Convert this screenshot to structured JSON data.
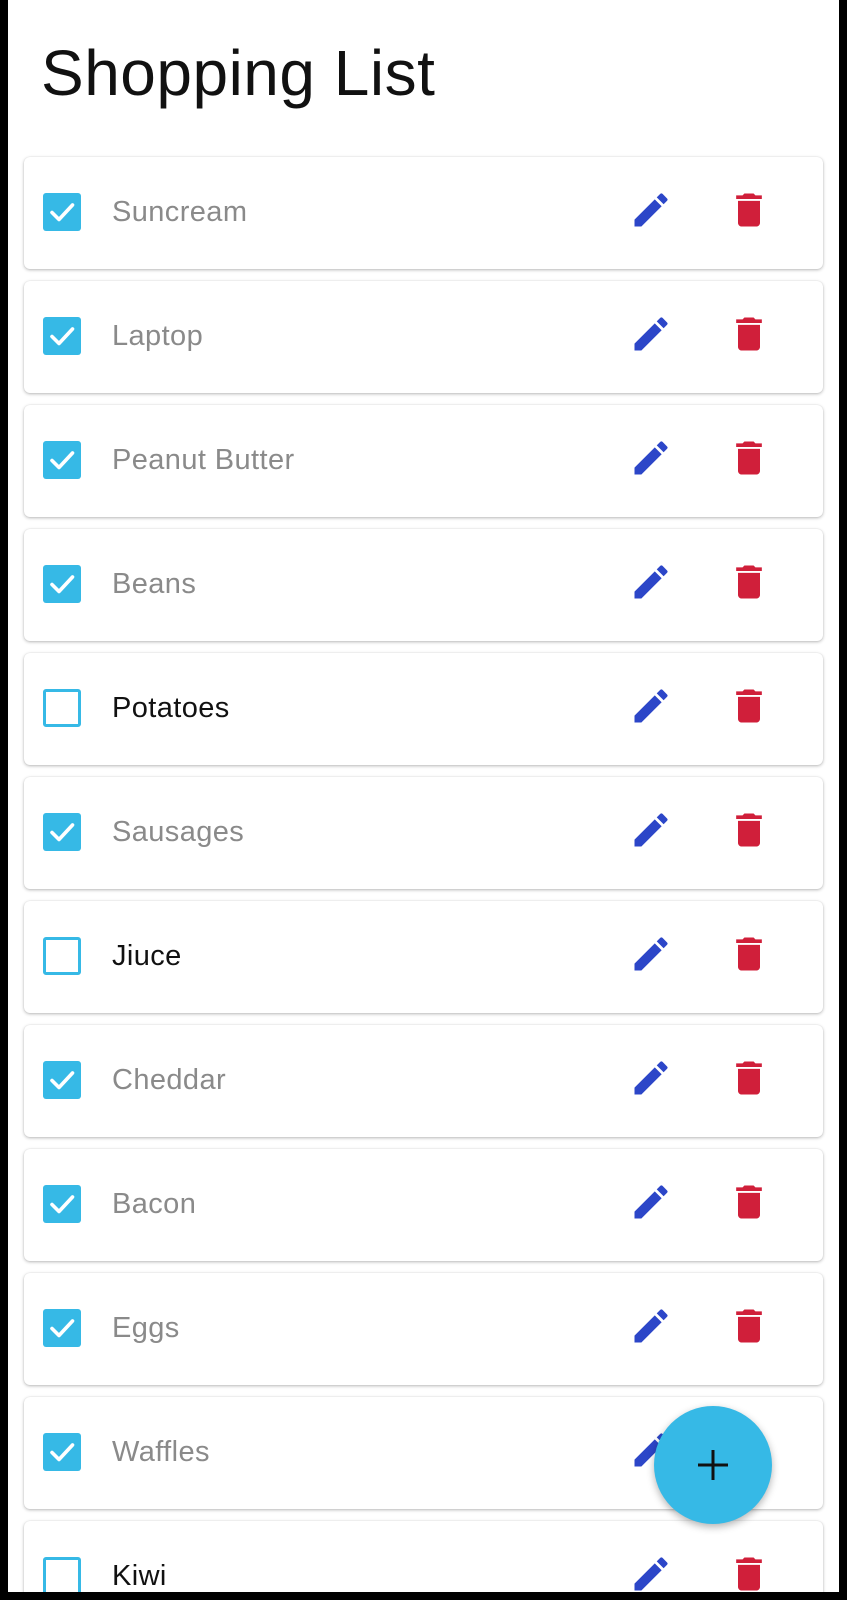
{
  "page": {
    "title": "Shopping List"
  },
  "colors": {
    "accent": "#36b9e6",
    "edit": "#2c46c8",
    "delete": "#d01f3a",
    "done_text": "#8a8a8a"
  },
  "icons": {
    "edit": "pencil-icon",
    "delete": "trash-icon",
    "add": "plus-icon",
    "checkbox": "check-icon"
  },
  "items": [
    {
      "label": "Suncream",
      "checked": true
    },
    {
      "label": "Laptop",
      "checked": true
    },
    {
      "label": "Peanut Butter",
      "checked": true
    },
    {
      "label": "Beans",
      "checked": true
    },
    {
      "label": "Potatoes",
      "checked": false
    },
    {
      "label": "Sausages",
      "checked": true
    },
    {
      "label": "Jiuce",
      "checked": false
    },
    {
      "label": "Cheddar",
      "checked": true
    },
    {
      "label": "Bacon",
      "checked": true
    },
    {
      "label": "Eggs",
      "checked": true
    },
    {
      "label": "Waffles",
      "checked": true
    },
    {
      "label": "Kiwi",
      "checked": false
    }
  ]
}
